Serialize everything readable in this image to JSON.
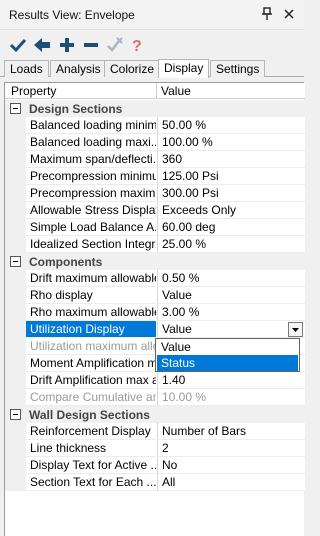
{
  "window": {
    "title": "Results View: Envelope"
  },
  "tabs": [
    "Loads",
    "Analysis",
    "Colorize",
    "Display",
    "Settings"
  ],
  "active_tab": "Display",
  "grid_header": {
    "property": "Property",
    "value": "Value"
  },
  "sections": [
    {
      "label": "Design Sections",
      "rows": [
        {
          "property": "Balanced loading minim...",
          "value": "50.00 %"
        },
        {
          "property": "Balanced loading maxi...",
          "value": "100.00 %"
        },
        {
          "property": "Maximum span/deflecti...",
          "value": "360"
        },
        {
          "property": "Precompression minimu...",
          "value": "125.00 Psi"
        },
        {
          "property": "Precompression maxim...",
          "value": "300.00 Psi"
        },
        {
          "property": "Allowable Stress Display",
          "value": "Exceeds Only"
        },
        {
          "property": "Simple Load Balance A...",
          "value": "60.00 deg"
        },
        {
          "property": "Idealized Section Integr...",
          "value": "25.00 %"
        }
      ]
    },
    {
      "label": "Components",
      "rows": [
        {
          "property": "Drift maximum allowable",
          "value": "0.50 %"
        },
        {
          "property": "Rho display",
          "value": "Value"
        },
        {
          "property": "Rho maximum allowable",
          "value": "3.00 %"
        },
        {
          "property": "Utilization Display",
          "value": "Value"
        },
        {
          "property": "Utilization maximum allo...",
          "value": ""
        },
        {
          "property": "Moment Amplification m...",
          "value": ""
        },
        {
          "property": "Drift Amplification max a...",
          "value": "1.40"
        },
        {
          "property": "Compare Cumulative an...",
          "value": "10.00 %"
        }
      ]
    },
    {
      "label": "Wall Design Sections",
      "rows": [
        {
          "property": "Reinforcement Display",
          "value": "Number of Bars"
        },
        {
          "property": "Line thickness",
          "value": "2"
        },
        {
          "property": "Display Text for Active ...",
          "value": "No"
        },
        {
          "property": "Section Text for Each ...",
          "value": "All"
        }
      ]
    }
  ],
  "dropdown": {
    "options": [
      "Value",
      "Status"
    ],
    "highlighted": "Status"
  },
  "colors": {
    "selection": "#0078d7",
    "apply": "#1f4e79",
    "help": "#e06b6b"
  }
}
